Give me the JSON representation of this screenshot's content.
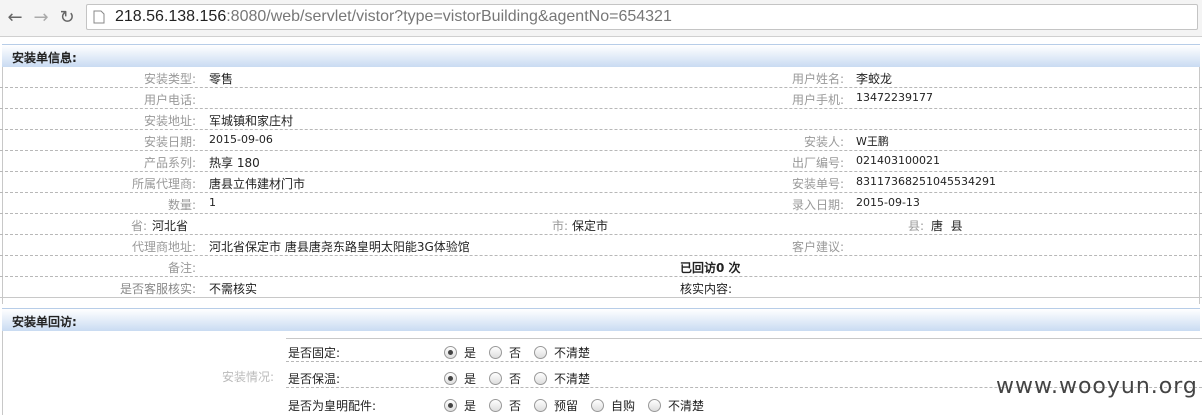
{
  "browser": {
    "url_host": "218.56.138.156",
    "url_rest": ":8080/web/servlet/vistor?type=vistorBuilding&agentNo=654321"
  },
  "section1": {
    "title": "安装单信息:"
  },
  "fields": {
    "install_type_label": "安装类型:",
    "install_type": "零售",
    "user_name_label": "用户姓名:",
    "user_name": "李蛟龙",
    "user_phone_label": "用户电话:",
    "user_phone": "",
    "user_mobile_label": "用户手机:",
    "user_mobile": "13472239177",
    "install_addr_label": "安装地址:",
    "install_addr": "军城镇和家庄村",
    "install_date_label": "安装日期:",
    "install_date": "2015-09-06",
    "installer_label": "安装人:",
    "installer": "W王鹏",
    "product_label": "产品系列:",
    "product": "热享 180",
    "factory_no_label": "出厂编号:",
    "factory_no": "021403100021",
    "agent_label": "所属代理商:",
    "agent": "唐县立伟建材门市",
    "order_no_label": "安装单号:",
    "order_no": "83117368251045534291",
    "qty_label": "数量:",
    "qty": "1",
    "entry_date_label": "录入日期:",
    "entry_date": "2015-09-13",
    "province_label": "省:",
    "province": "河北省",
    "city_label": "市:",
    "city": "保定市",
    "county_label": "县:",
    "county": "唐  县",
    "agent_addr_label": "代理商地址:",
    "agent_addr": "河北省保定市 唐县唐尧东路皇明太阳能3G体验馆",
    "suggestion_label": "客户建议:",
    "suggestion": "",
    "remark_label": "备注:",
    "remark": "",
    "visited": "已回访0 次",
    "verify_label": "是否客服核实:",
    "verify": "不需核实",
    "verify_content_label": "核实内容:",
    "verify_content": ""
  },
  "section2": {
    "title": "安装单回访:"
  },
  "revisit": {
    "group_label": "安装情况:",
    "questions": [
      {
        "q": "是否固定:",
        "options": [
          "是",
          "否",
          "不清楚"
        ],
        "selected": 0
      },
      {
        "q": "是否保温:",
        "options": [
          "是",
          "否",
          "不清楚"
        ],
        "selected": 0
      },
      {
        "q": "是否为皇明配件:",
        "options": [
          "是",
          "否",
          "预留",
          "自购",
          "不清楚"
        ],
        "selected": 0
      }
    ]
  },
  "watermark": "www.wooyun.org"
}
